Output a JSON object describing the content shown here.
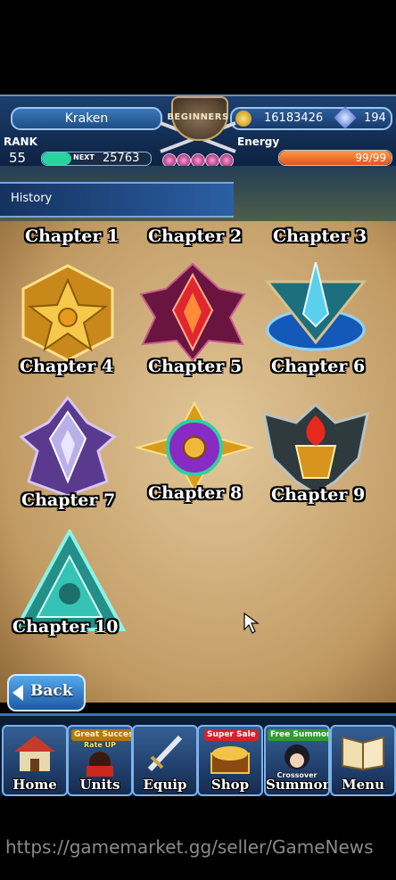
{
  "header": {
    "player_name": "Kraken",
    "zel": "16183426",
    "gems": "194",
    "rank_label": "RANK",
    "rank": "55",
    "next_label": "NEXT",
    "next_exp": "25763",
    "exp_progress": 0.27,
    "energy_label": "Energy",
    "energy": "99/99",
    "energy_progress": 1.0,
    "emblem_text": "BEGINNERS"
  },
  "page": {
    "title": "History"
  },
  "chapters": [
    {
      "label": "Chapter 1"
    },
    {
      "label": "Chapter 2"
    },
    {
      "label": "Chapter 3"
    },
    {
      "label": "Chapter 4",
      "color": "#e0a324"
    },
    {
      "label": "Chapter 5",
      "color": "#c3232e"
    },
    {
      "label": "Chapter 6",
      "color": "#2a8ad8"
    },
    {
      "label": "Chapter 7",
      "color": "#9a7bd2"
    },
    {
      "label": "Chapter 8",
      "color": "#b545d8"
    },
    {
      "label": "Chapter 9",
      "color": "#8a3a1e"
    },
    {
      "label": "Chapter 10",
      "color": "#2db2a6"
    }
  ],
  "back_label": "Back",
  "nav": {
    "home": {
      "label": "Home"
    },
    "units": {
      "label": "Units",
      "tag": "Great Success",
      "tag2": "Rate UP"
    },
    "equip": {
      "label": "Equip"
    },
    "shop": {
      "label": "Shop",
      "tag": "Super Sale"
    },
    "summon": {
      "label": "Summon",
      "tag": "Free Summon",
      "sub": "Crossover"
    },
    "menu": {
      "label": "Menu"
    }
  },
  "watermark": "https://gamemarket.gg/seller/GameNews"
}
